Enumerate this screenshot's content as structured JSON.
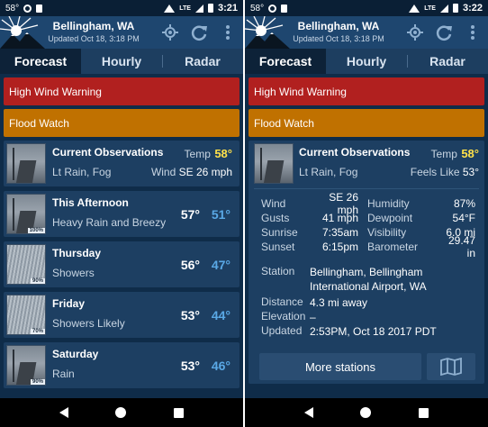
{
  "left": {
    "status": {
      "temp": "58°",
      "time": "3:21",
      "network": "LTE"
    },
    "header": {
      "city": "Bellingham, WA",
      "updated": "Updated Oct 18, 3:18 PM"
    },
    "tabs": [
      {
        "label": "Forecast"
      },
      {
        "label": "Hourly"
      },
      {
        "label": "Radar"
      }
    ],
    "alerts": [
      {
        "label": "High Wind Warning"
      },
      {
        "label": "Flood Watch"
      }
    ],
    "current": {
      "title": "Current Observations",
      "condition": "Lt Rain, Fog",
      "temp_label": "Temp",
      "temp_value": "58°",
      "wind_label": "Wind",
      "wind_value": "SE 26 mph"
    },
    "forecast": [
      {
        "title": "This Afternoon",
        "summary": "Heavy Rain and Breezy",
        "high": "57°",
        "low": "51°",
        "pop": "100%"
      },
      {
        "title": "Thursday",
        "summary": "Showers",
        "high": "56°",
        "low": "47°",
        "pop": "90%"
      },
      {
        "title": "Friday",
        "summary": "Showers Likely",
        "high": "53°",
        "low": "44°",
        "pop": "70%"
      },
      {
        "title": "Saturday",
        "summary": "Rain",
        "high": "53°",
        "low": "46°",
        "pop": "90%"
      }
    ]
  },
  "right": {
    "status": {
      "temp": "58°",
      "time": "3:22",
      "network": "LTE"
    },
    "header": {
      "city": "Bellingham, WA",
      "updated": "Updated Oct 18, 3:18 PM"
    },
    "tabs": [
      {
        "label": "Forecast"
      },
      {
        "label": "Hourly"
      },
      {
        "label": "Radar"
      }
    ],
    "alerts": [
      {
        "label": "High Wind Warning"
      },
      {
        "label": "Flood Watch"
      }
    ],
    "current": {
      "title": "Current Observations",
      "condition": "Lt Rain, Fog",
      "temp_label": "Temp",
      "temp_value": "58°",
      "feels_label": "Feels Like",
      "feels_value": "53°"
    },
    "details": [
      {
        "label": "Wind",
        "value": "SE 26 mph",
        "label2": "Humidity",
        "value2": "87%"
      },
      {
        "label": "Gusts",
        "value": "41 mph",
        "label2": "Dewpoint",
        "value2": "54°F"
      },
      {
        "label": "Sunrise",
        "value": "7:35am",
        "label2": "Visibility",
        "value2": "6.0 mi"
      },
      {
        "label": "Sunset",
        "value": "6:15pm",
        "label2": "Barometer",
        "value2": "29.47 in"
      }
    ],
    "station": {
      "station_label": "Station",
      "station_value": "Bellingham, Bellingham International Airport, WA",
      "distance_label": "Distance",
      "distance_value": "4.3 mi away",
      "elevation_label": "Elevation",
      "elevation_value": "–",
      "updated_label": "Updated",
      "updated_value": "2:53PM, Oct 18 2017 PDT"
    },
    "more_label": "More stations"
  },
  "colors": {
    "warning": "#b1201f",
    "watch": "#c07100",
    "accent_yellow": "#ffe14a",
    "low_temp": "#5aa9e6"
  }
}
